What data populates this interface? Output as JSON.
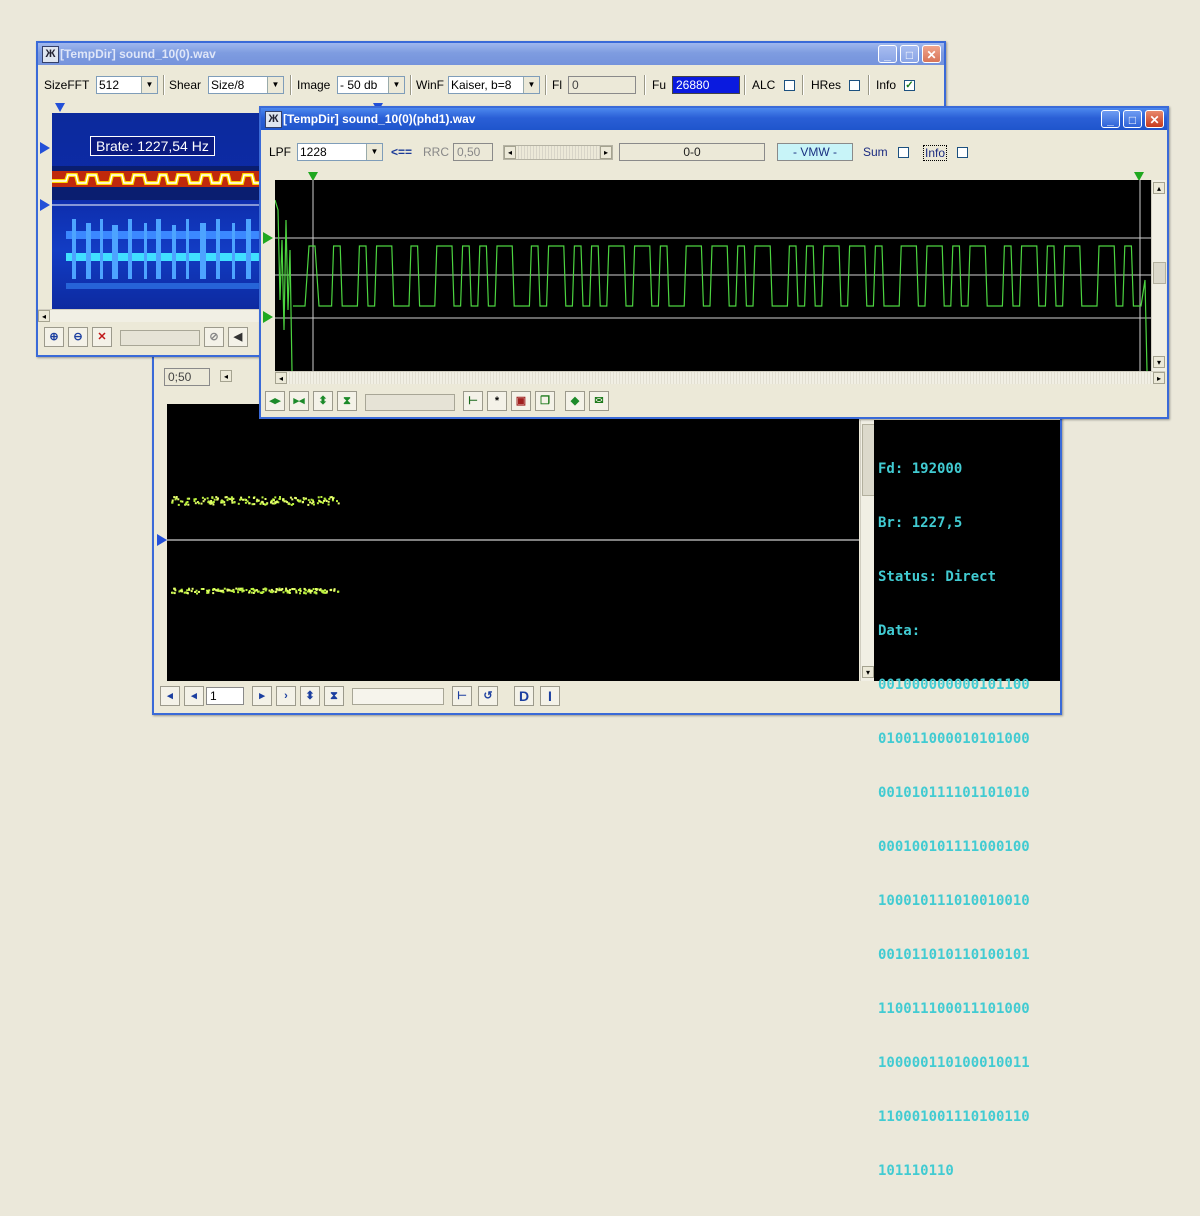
{
  "back_window": {
    "status_field": "0;50",
    "page_value": "1",
    "bottom_icons": [
      "arrow-left-icon",
      "step-left-icon",
      "step-right-icon",
      "arrow-right-icon",
      "expand-vertical-icon",
      "compress-vertical-icon",
      "export-icon",
      "refresh-icon",
      "d-icon",
      "i-icon"
    ],
    "info": {
      "fd": "Fd: 192000",
      "br": "Br: 1227,5",
      "status": "Status: Direct",
      "data_label": "Data:",
      "data_lines": [
        "001000000000101100",
        "010011000010101000",
        "001010111101101010",
        "000100101111000100",
        "100010111010010010",
        "001011010110100101",
        "110011100011101000",
        "100000110100010011",
        "110001001110100110",
        "101110110"
      ]
    },
    "partial_labels": {
      "rrc": "RRC",
      "lpf": "1228"
    }
  },
  "window1": {
    "title": "[TempDir] sound_10(0).wav",
    "toolbar": {
      "sizefft_label": "SizeFFT",
      "sizefft_value": "512",
      "shear_label": "Shear",
      "shear_value": "Size/8",
      "image_label": "Image",
      "image_value": "- 50 db",
      "winf_label": "WinF",
      "winf_value": "Kaiser, b=8",
      "fl_label": "Fl",
      "fl_value": "0",
      "fu_label": "Fu",
      "fu_value": "26880",
      "alc_label": "ALC",
      "alc_checked": false,
      "hres_label": "HRes",
      "hres_checked": false,
      "info_label": "Info",
      "info_checked": true
    },
    "brate": "Brate: 1227,54 Hz",
    "bottom_icons": [
      "zoom-in-icon",
      "zoom-out-icon",
      "clear-icon",
      "block-icon",
      "speaker-icon"
    ]
  },
  "window2": {
    "title": "[TempDir] sound_10(0)(phd1).wav",
    "toolbar": {
      "lpf_label": "LPF",
      "lpf_value": "1228",
      "arrow_label": "<==",
      "rrc_label": "RRC",
      "rrc_value": "0,50",
      "counter": "0-0",
      "vmw": "- VMW -",
      "sum_label": "Sum",
      "sum_checked": false,
      "info_label": "Info",
      "info_checked": false
    },
    "bottom_icons": [
      "stretch-horizontal-icon",
      "shrink-horizontal-icon",
      "expand-vertical-icon",
      "compress-vertical-icon",
      "corner-icon",
      "asterisk-icon",
      "paste-icon",
      "copy-icon",
      "diamond-icon",
      "envelope-icon"
    ]
  },
  "colors": {
    "signal_green": "#4cd440",
    "data_cyan": "#41cbd2",
    "fu_highlight": "#0a1adf",
    "vmw_bg": "#c8f4f8",
    "marker_blue": "#2350d8",
    "marker_green": "#1fa81f"
  }
}
